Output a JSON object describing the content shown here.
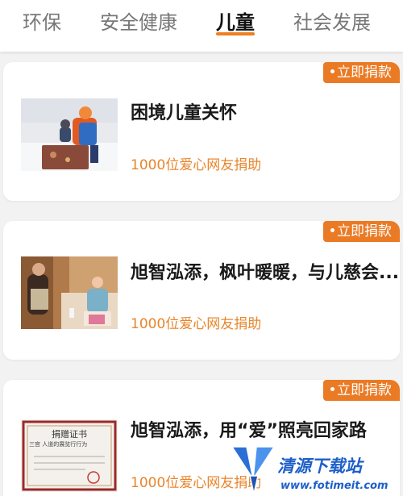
{
  "tabs": [
    {
      "label": "环保",
      "active": false
    },
    {
      "label": "安全健康",
      "active": false
    },
    {
      "label": "儿童",
      "active": true
    },
    {
      "label": "社会发展",
      "active": false
    }
  ],
  "accent_color": "#ea7a24",
  "cards": [
    {
      "badge": "立即捐款",
      "title": "困境儿童关怀",
      "donors": "1000位爱心网友捐助",
      "image": "child-in-snow-photo"
    },
    {
      "badge": "立即捐款",
      "title": "旭智泓添，枫叶暖暖，与儿慈会...",
      "donors": "1000位爱心网友捐助",
      "image": "volunteers-visit-photo"
    },
    {
      "badge": "立即捐款",
      "title": "旭智泓添，用“爱”照亮回家路",
      "donors": "1000位爱心网友捐助",
      "image": "donation-certificate-photo",
      "certificate": {
        "heading": "捐赠证书",
        "line": "三宫    人道的展览行行为"
      }
    }
  ],
  "watermark": {
    "brand": "清源下载站",
    "url": "www.fotimeit.com"
  }
}
